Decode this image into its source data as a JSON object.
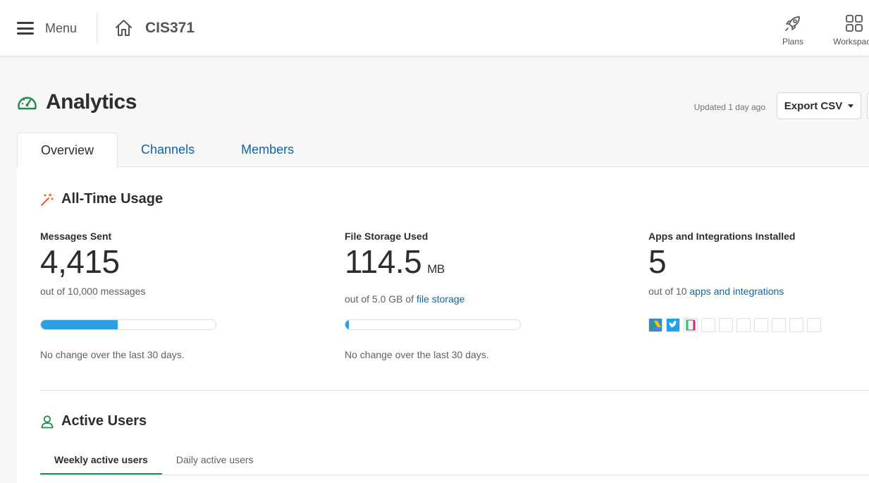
{
  "topbar": {
    "menu_label": "Menu",
    "workspace_name": "CIS371",
    "actions": [
      {
        "label": "Plans",
        "icon": "rocket-icon"
      },
      {
        "label": "Workspace",
        "icon": "grid-icon"
      }
    ]
  },
  "header": {
    "title": "Analytics",
    "updated": "Updated 1 day ago",
    "export_label": "Export CSV"
  },
  "tabs": [
    {
      "label": "Overview",
      "active": true
    },
    {
      "label": "Channels",
      "active": false
    },
    {
      "label": "Members",
      "active": false
    }
  ],
  "usage": {
    "title": "All-Time Usage",
    "messages": {
      "label": "Messages Sent",
      "value": "4,415",
      "sub": "out of 10,000 messages",
      "progress": 0.4415,
      "change": "No change over the last 30 days."
    },
    "storage": {
      "label": "File Storage Used",
      "value": "114.5",
      "unit": "MB",
      "sub_prefix": "out of 5.0 GB of ",
      "sub_link": "file storage",
      "progress": 0.022,
      "change": "No change over the last 30 days."
    },
    "apps": {
      "label": "Apps and Integrations Installed",
      "value": "5",
      "sub_prefix": "out of 10 ",
      "sub_link": "apps and integrations",
      "installed_icons": [
        "google-drive-icon",
        "twitter-icon",
        "notes-app-icon"
      ],
      "slots_total": 10
    }
  },
  "active_users": {
    "title": "Active Users",
    "subtabs": [
      {
        "label": "Weekly active users",
        "active": true
      },
      {
        "label": "Daily active users",
        "active": false
      }
    ]
  },
  "colors": {
    "accent": "#1264a3",
    "progress": "#2d9ee0",
    "success": "#1f8c4c",
    "wand": "#e8623a"
  }
}
